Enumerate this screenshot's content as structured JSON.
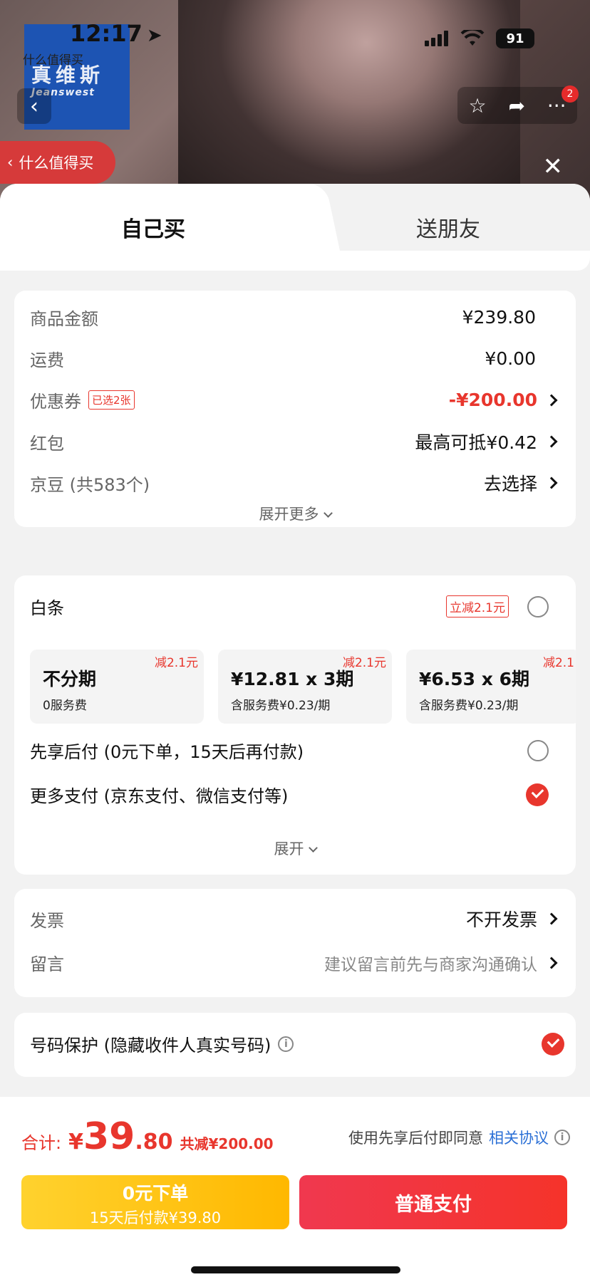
{
  "status": {
    "time": "12:17",
    "battery": "91"
  },
  "header": {
    "brand_small": "什么值得买",
    "brand_logo": "真维斯",
    "brand_logo_sub": "Jeanswest",
    "back_pill": "什么值得买",
    "notif_count": "2"
  },
  "tabs": {
    "self": "自己买",
    "gift": "送朋友"
  },
  "order": {
    "rows": [
      {
        "label": "商品金额",
        "value": "¥239.80"
      },
      {
        "label": "运费",
        "value": "¥0.00"
      },
      {
        "label": "优惠券",
        "tag": "已选2张",
        "value": "-¥200.00"
      },
      {
        "label": "红包",
        "value": "最高可抵¥0.42"
      },
      {
        "label": "京豆 (共583个)",
        "value": "去选择"
      }
    ],
    "expand_more": "展开更多"
  },
  "payment": {
    "baitiao_label": "白条",
    "baitiao_tag": "立减2.1元",
    "plans": [
      {
        "discount": "减2.1元",
        "title": "不分期",
        "sub": "0服务费"
      },
      {
        "discount": "减2.1元",
        "title": "¥12.81 x 3期",
        "sub": "含服务费¥0.23/期"
      },
      {
        "discount": "减2.1",
        "title": "¥6.53 x 6期",
        "sub": "含服务费¥0.23/期"
      }
    ],
    "pay_later": "先享后付 (0元下单，15天后再付款)",
    "more_pay": "更多支付 (京东支付、微信支付等)",
    "expand": "展开"
  },
  "invoice": {
    "invoice_label": "发票",
    "invoice_value": "不开发票",
    "note_label": "留言",
    "note_placeholder": "建议留言前先与商家沟通确认"
  },
  "privacy": {
    "label": "号码保护 (隐藏收件人真实号码)"
  },
  "footer": {
    "total_label": "合计:",
    "currency": "¥",
    "total_int": "39",
    "total_dec": ".80",
    "saved": "共减¥200.00",
    "agree_text": "使用先享后付即同意",
    "agree_link": "相关协议",
    "btn_later_l1": "0元下单",
    "btn_later_l2": "15天后付款¥39.80",
    "btn_pay": "普通支付"
  },
  "colors": {
    "accent": "#e8362d",
    "link": "#2a6fd6",
    "yellow": "#ffc21a"
  }
}
